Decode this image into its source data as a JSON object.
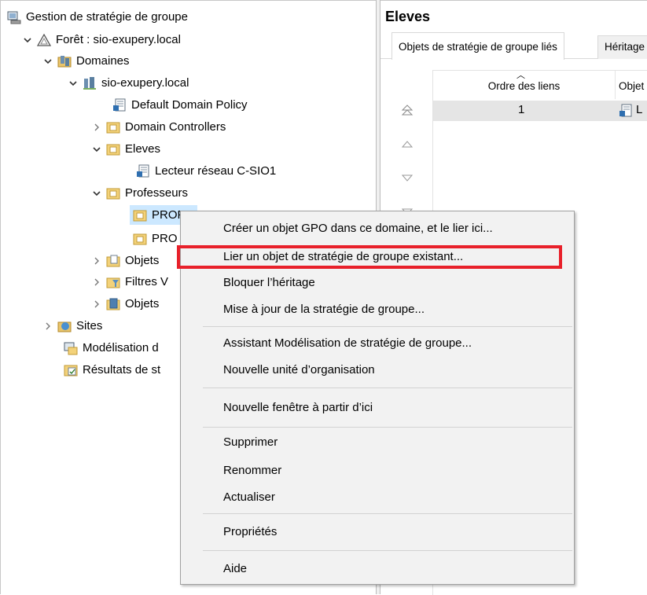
{
  "tree": {
    "root": {
      "label": "Gestion de stratégie de groupe",
      "icon": "gpm-console-icon"
    },
    "forest": {
      "label": "Forêt : sio-exupery.local",
      "icon": "forest-icon"
    },
    "domains": {
      "label": "Domaines",
      "icon": "domains-icon"
    },
    "domain": {
      "label": "sio-exupery.local",
      "icon": "domain-icon"
    },
    "default_policy": {
      "label": "Default Domain Policy",
      "icon": "gpo-link-icon"
    },
    "domain_controllers": {
      "label": "Domain Controllers",
      "icon": "ou-icon"
    },
    "eleves": {
      "label": "Eleves",
      "icon": "ou-icon"
    },
    "lecteur": {
      "label": "Lecteur réseau C-SIO1",
      "icon": "gpo-link-icon"
    },
    "professeurs": {
      "label": "Professeurs",
      "icon": "ou-icon"
    },
    "prof1": {
      "label": "PROF",
      "icon": "ou-icon"
    },
    "prof2": {
      "label": "PRO",
      "icon": "ou-icon"
    },
    "objets": {
      "label": "Objets",
      "icon": "gpo-folder-icon"
    },
    "filtres": {
      "label": "Filtres V",
      "icon": "wmi-filter-icon"
    },
    "objets2": {
      "label": "Objets",
      "icon": "starter-gpo-icon"
    },
    "sites": {
      "label": "Sites",
      "icon": "sites-icon"
    },
    "modelisation": {
      "label": "Modélisation d",
      "icon": "modeling-icon"
    },
    "resultats": {
      "label": "Résultats de st",
      "icon": "results-icon"
    }
  },
  "right_pane": {
    "title": "Eleves",
    "tabs": [
      "Objets de stratégie de groupe liés",
      "Héritage"
    ],
    "columns": [
      "Ordre des liens",
      "Objet"
    ],
    "rows": [
      {
        "order": "1",
        "object": "L"
      }
    ]
  },
  "context_menu": {
    "items": [
      "Créer un objet GPO dans ce domaine, et le lier ici...",
      "Lier un objet de stratégie de groupe existant...",
      "Bloquer l’héritage",
      "Mise à jour de la stratégie de groupe...",
      "Assistant Modélisation de stratégie de groupe...",
      "Nouvelle unité d’organisation",
      "Nouvelle fenêtre à partir d’ici",
      "Supprimer",
      "Renommer",
      "Actualiser",
      "Propriétés",
      "Aide"
    ],
    "highlighted_index": 1,
    "highlight_color": "#e8202a"
  }
}
